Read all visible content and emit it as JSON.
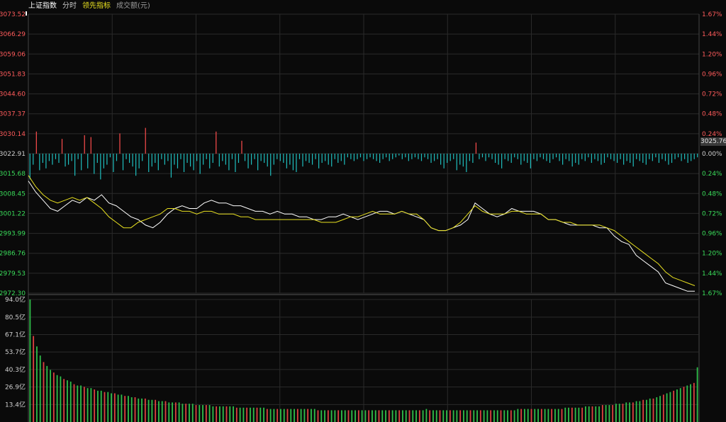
{
  "header": {
    "index_name": "上证指数",
    "period": "分时",
    "indicator_name": "领先指标",
    "volume_label": "成交额(元)"
  },
  "current_price_tag": "3025.76",
  "colors": {
    "background": "#0a0a0a",
    "grid": "#2a2a2a",
    "up": "#ff4d4d",
    "down": "#1fbfbf",
    "up_text": "#ff5b5b",
    "down_text": "#3adc5a",
    "neutral_text": "#d0d0d0",
    "price_line": "#ffffff",
    "avg_line": "#e8e020",
    "volume_up": "#e04040",
    "volume_down": "#2fc04a"
  },
  "chart_data": [
    {
      "type": "line",
      "title": "上证指数 分时",
      "y_left_ticks": [
        "3073.52",
        "3066.29",
        "3059.06",
        "3051.83",
        "3044.60",
        "3037.37",
        "3030.14",
        "3022.91",
        "3015.68",
        "3008.45",
        "3001.22",
        "2993.99",
        "2986.76",
        "2979.53",
        "2972.30"
      ],
      "y_right_ticks": [
        "1.67%",
        "1.44%",
        "1.20%",
        "0.96%",
        "0.72%",
        "0.48%",
        "0.24%",
        "0.00%",
        "0.24%",
        "0.48%",
        "0.72%",
        "0.96%",
        "1.20%",
        "1.44%",
        "1.67%"
      ],
      "ylim": [
        2972.3,
        3073.52
      ],
      "base": 3022.91,
      "series": [
        {
          "values": [
            3013,
            3009,
            3006,
            3003,
            3002,
            3004,
            3006,
            3005,
            3007,
            3006,
            3008,
            3005,
            3004,
            3002,
            3000,
            2999,
            2997,
            2996,
            2998,
            3001,
            3003,
            3004,
            3003,
            3003,
            3005,
            3006,
            3005,
            3005,
            3004,
            3004,
            3003,
            3002,
            3002,
            3001,
            3002,
            3001,
            3001,
            3000,
            3000,
            2999,
            2999,
            3000,
            3000,
            3001,
            3000,
            2999,
            3000,
            3001,
            3002,
            3002,
            3001,
            3002,
            3001,
            3000,
            2999,
            2996,
            2995,
            2995,
            2996,
            2997,
            2999,
            3005,
            3003,
            3001,
            3000,
            3001,
            3003,
            3002,
            3002,
            3002,
            3001,
            2999,
            2999,
            2998,
            2997,
            2997,
            2997,
            2997,
            2996,
            2996,
            2993,
            2991,
            2990,
            2986,
            2984,
            2982,
            2980,
            2976,
            2975,
            2974,
            2973,
            2973
          ]
        },
        {
          "values": [
            3015,
            3011,
            3008,
            3006,
            3005,
            3006,
            3007,
            3006,
            3007,
            3005,
            3003,
            3000,
            2998,
            2996,
            2996,
            2998,
            2999,
            3000,
            3001,
            3003,
            3003,
            3002,
            3002,
            3001,
            3002,
            3002,
            3001,
            3001,
            3001,
            3000,
            3000,
            2999,
            2999,
            2999,
            2999,
            2999,
            2999,
            2999,
            2999,
            2999,
            2998,
            2998,
            2998,
            2999,
            3000,
            3000,
            3001,
            3002,
            3001,
            3001,
            3001,
            3002,
            3001,
            3001,
            2999,
            2996,
            2995,
            2995,
            2996,
            2998,
            3001,
            3004,
            3002,
            3001,
            3001,
            3001,
            3002,
            3002,
            3001,
            3001,
            3001,
            2999,
            2999,
            2998,
            2998,
            2997,
            2997,
            2997,
            2997,
            2996,
            2995,
            2993,
            2991,
            2989,
            2987,
            2985,
            2983,
            2980,
            2978,
            2977,
            2976,
            2975
          ]
        }
      ]
    },
    {
      "type": "bar",
      "title": "领先指标",
      "values": [
        -14,
        -6,
        12,
        -9,
        -5,
        -8,
        -4,
        -6,
        -3,
        -5,
        8,
        -7,
        -6,
        -4,
        -12,
        -3,
        -9,
        10,
        -8,
        9,
        -11,
        -5,
        -14,
        -8,
        -6,
        -2,
        -10,
        -4,
        11,
        -9,
        -3,
        -5,
        -7,
        -12,
        -8,
        -4,
        14,
        -10,
        -7,
        -5,
        -9,
        -3,
        -6,
        -4,
        -13,
        -6,
        -8,
        -3,
        -10,
        -5,
        -7,
        -9,
        -4,
        -11,
        -6,
        -3,
        -8,
        -5,
        12,
        -7,
        -4,
        -6,
        -9,
        -3,
        -10,
        -5,
        7,
        -4,
        -8,
        -6,
        -3,
        -9,
        -4,
        -5,
        -7,
        -12,
        -6,
        -3,
        -4,
        -5,
        -8,
        -6,
        -9,
        -10,
        -3,
        -7,
        -4,
        -5,
        -6,
        -3,
        -8,
        -5,
        -4,
        -6,
        -7,
        -3,
        -5,
        -4,
        -6,
        -2,
        -3,
        -4,
        -3,
        -2,
        -4,
        -3,
        -2,
        -3,
        -4,
        -5,
        -3,
        -2,
        -4,
        -3,
        -2,
        -1,
        -3,
        -2,
        -4,
        -3,
        -2,
        -3,
        -4,
        -2,
        -3,
        -5,
        -4,
        -3,
        -6,
        -8,
        -5,
        -4,
        -3,
        -9,
        -6,
        -7,
        -10,
        -4,
        -5,
        6,
        -3,
        -2,
        -4,
        -2,
        -3,
        -5,
        -6,
        -8,
        -3,
        -4,
        -5,
        -2,
        -3,
        -6,
        -4,
        -5,
        -8,
        -3,
        -4,
        -2,
        -3,
        -4,
        -5,
        -3,
        -2,
        -4,
        -6,
        -3,
        -4,
        -7,
        -5,
        -6,
        -3,
        -4,
        -2,
        -5,
        -3,
        -4,
        -6,
        -5,
        -2,
        -3,
        -4,
        -5,
        -3,
        -6,
        -4,
        -5,
        -7,
        -3,
        -4,
        -5,
        -6,
        -3,
        -4,
        -2,
        -5,
        -3,
        -4,
        -6,
        -5,
        -3,
        -2,
        -4,
        -3,
        -5,
        -4,
        -3,
        -2
      ]
    },
    {
      "type": "bar",
      "title": "成交额(元)",
      "y_ticks": [
        "94.0亿",
        "80.5亿",
        "67.1亿",
        "53.7亿",
        "40.3亿",
        "26.9亿",
        "13.4亿"
      ],
      "ylim": [
        0,
        94.0
      ],
      "values": [
        94,
        66,
        58,
        51,
        46,
        43,
        40,
        38,
        36,
        35,
        33,
        32,
        31,
        29,
        28,
        28,
        27,
        26,
        26,
        25,
        24,
        24,
        23,
        23,
        22,
        22,
        21,
        21,
        20,
        20,
        19,
        19,
        18,
        18,
        18,
        17,
        17,
        17,
        16,
        16,
        16,
        15,
        15,
        15,
        15,
        14,
        14,
        14,
        14,
        13,
        13,
        13,
        13,
        13,
        12,
        12,
        12,
        12,
        12,
        12,
        12,
        11,
        11,
        11,
        11,
        11,
        11,
        11,
        11,
        11,
        10,
        10,
        10,
        10,
        10,
        10,
        10,
        10,
        10,
        10,
        10,
        10,
        10,
        10,
        10,
        9,
        9,
        9,
        9,
        9,
        9,
        9,
        9,
        9,
        9,
        9,
        9,
        9,
        9,
        9,
        9,
        9,
        9,
        9,
        9,
        9,
        9,
        9,
        9,
        9,
        9,
        9,
        9,
        9,
        9,
        9,
        9,
        10,
        9,
        9,
        9,
        9,
        9,
        9,
        9,
        9,
        9,
        9,
        9,
        9,
        9,
        9,
        9,
        9,
        9,
        9,
        9,
        9,
        9,
        9,
        9,
        9,
        9,
        9,
        10,
        10,
        10,
        10,
        10,
        10,
        10,
        10,
        10,
        10,
        10,
        10,
        10,
        10,
        11,
        11,
        11,
        11,
        11,
        11,
        12,
        12,
        12,
        12,
        12,
        13,
        13,
        13,
        13,
        14,
        14,
        14,
        15,
        15,
        15,
        16,
        16,
        17,
        17,
        18,
        18,
        19,
        20,
        21,
        22,
        23,
        24,
        25,
        26,
        27,
        28,
        29,
        30,
        42
      ]
    }
  ]
}
